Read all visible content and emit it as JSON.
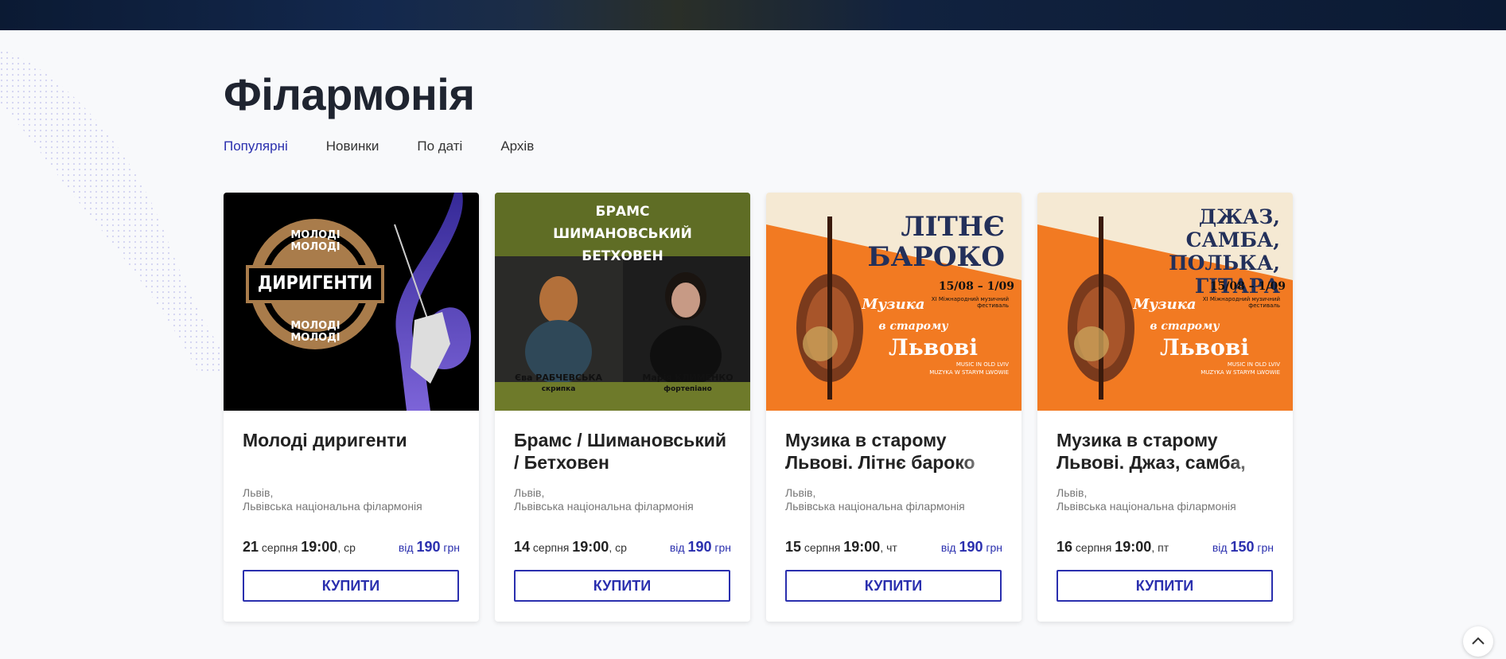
{
  "page": {
    "title": "Філармонія"
  },
  "tabs": [
    {
      "label": "Популярні",
      "active": true
    },
    {
      "label": "Новинки"
    },
    {
      "label": "По даті"
    },
    {
      "label": "Архів"
    }
  ],
  "colors": {
    "accent": "#2a2fae",
    "title": "#1f2430"
  },
  "cards": [
    {
      "title": "Молоді диригенти",
      "city": "Львів,",
      "venue": "Львівська національна філармонія",
      "day": "21",
      "month": "серпня",
      "time": "19:00",
      "weekday": ", ср",
      "price_prefix": "від",
      "price": "190",
      "currency": "грн",
      "buy_label": "КУПИТИ",
      "poster": {
        "top": "МОЛОДІ МОЛОДІ",
        "center": "ДИРИГЕНТИ",
        "bottom": "МОЛОДІ МОЛОДІ"
      }
    },
    {
      "title": "Брамс / Шимановський / Бетховен",
      "city": "Львів,",
      "venue": "Львівська національна філармонія",
      "day": "14",
      "month": "серпня",
      "time": "19:00",
      "weekday": ", ср",
      "price_prefix": "від",
      "price": "190",
      "currency": "грн",
      "buy_label": "КУПИТИ",
      "poster": {
        "line1": "БРАМС",
        "line2": "ШИМАНОВСЬКИЙ",
        "line3": "БЕТХОВЕН",
        "left_name": "Єва РАБЧЕВСЬКА",
        "left_role": "скрипка",
        "right_name": "Марія КЛИМЕНКО",
        "right_role": "фортепіано"
      }
    },
    {
      "title": "Музика в старому Львові. Літнє бароко",
      "city": "Львів,",
      "venue": "Львівська національна філармонія",
      "day": "15",
      "month": "серпня",
      "time": "19:00",
      "weekday": ", чт",
      "price_prefix": "від",
      "price": "190",
      "currency": "грн",
      "buy_label": "КУПИТИ",
      "poster": {
        "heading1": "ЛІТНЄ",
        "heading2": "БАРОКО",
        "dates": "15/08 – 1/09",
        "festival": "XI Міжнародний музичний фестиваль",
        "logo1": "Музика",
        "logo2": "в старому",
        "logo3": "Львові",
        "en1": "MUSIC IN OLD LVIV",
        "en2": "MUZYKA W STARYM LWOWIE"
      }
    },
    {
      "title": "Музика в старому Львові. Джаз, самба, полька, гітара",
      "city": "Львів,",
      "venue": "Львівська національна філармонія",
      "day": "16",
      "month": "серпня",
      "time": "19:00",
      "weekday": ", пт",
      "price_prefix": "від",
      "price": "150",
      "currency": "грн",
      "buy_label": "КУПИТИ",
      "poster": {
        "heading1": "ДЖАЗ, САМБА,",
        "heading2": "ПОЛЬКА,",
        "heading3": "ГІТАРА",
        "dates": "15/08 – 1/09",
        "festival": "XI Міжнародний музичний фестиваль",
        "logo1": "Музика",
        "logo2": "в старому",
        "logo3": "Львові",
        "en1": "MUSIC IN OLD LVIV",
        "en2": "MUZYKA W STARYM LWOWIE"
      }
    }
  ]
}
